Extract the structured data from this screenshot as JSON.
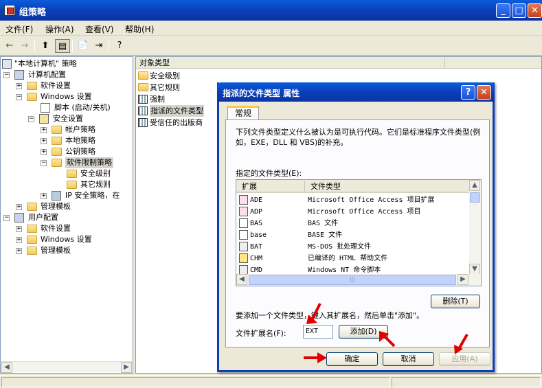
{
  "window": {
    "title": "组策略",
    "controls": [
      "_",
      "□",
      "✕"
    ]
  },
  "menu": [
    {
      "label": "文件(F)"
    },
    {
      "label": "操作(A)"
    },
    {
      "label": "查看(V)"
    },
    {
      "label": "帮助(H)"
    }
  ],
  "toolbar": {
    "back": "←",
    "forward": "→",
    "up": "⬆",
    "show_tree": "▤",
    "properties": "📄",
    "export": "⇥",
    "help": "?"
  },
  "tree": {
    "root": "\"本地计算机\" 策略",
    "computer_config": "计算机配置",
    "software_settings": "软件设置",
    "windows_settings": "Windows 设置",
    "scripts": "脚本 (启动/关机)",
    "security_settings": "安全设置",
    "account_policies": "帐户策略",
    "local_policies": "本地策略",
    "public_key_policies": "公钥策略",
    "srp": "软件限制策略",
    "security_levels": "安全级别",
    "additional_rules": "其它规则",
    "ip_security": "IP 安全策略，在",
    "admin_templates": "管理模板",
    "user_config": "用户配置",
    "user_software_settings": "软件设置",
    "user_windows_settings": "Windows 设置",
    "user_admin_templates": "管理模板"
  },
  "list": {
    "column": "对象类型",
    "items": [
      {
        "label": "安全级别",
        "icon": "folder"
      },
      {
        "label": "其它规则",
        "icon": "folder"
      },
      {
        "label": "强制",
        "icon": "rule"
      },
      {
        "label": "指派的文件类型",
        "icon": "rule"
      },
      {
        "label": "受信任的出版商",
        "icon": "rule"
      }
    ]
  },
  "dialog": {
    "title": "指派的文件类型 属性",
    "help_btn": "?",
    "close_btn": "✕",
    "tab": "常规",
    "description": "下列文件类型定义什么被认为是可执行代码。它们是标准程序文件类型(例如，EXE，DLL 和 VBS)的补充。",
    "list_label": "指定的文件类型(E):",
    "col_ext": "扩展",
    "col_type": "文件类型",
    "file_types": [
      {
        "ext": "ADE",
        "type": "Microsoft Office Access 项目扩展"
      },
      {
        "ext": "ADP",
        "type": "Microsoft Office Access 项目"
      },
      {
        "ext": "BAS",
        "type": "BAS 文件"
      },
      {
        "ext": "base",
        "type": "BASE 文件"
      },
      {
        "ext": "BAT",
        "type": "MS-DOS 批处理文件"
      },
      {
        "ext": "CHM",
        "type": "已编译的 HTML 帮助文件"
      },
      {
        "ext": "CMD",
        "type": "Windows NT 命令脚本"
      }
    ],
    "delete_btn": "删除(T)",
    "instruction": "要添加一个文件类型，键入其扩展名，然后单击\"添加\"。",
    "ext_label": "文件扩展名(F):",
    "ext_value": "EXT",
    "add_btn": "添加(D)",
    "ok_btn": "确定",
    "cancel_btn": "取消",
    "apply_btn": "应用(A)"
  },
  "annotation_color": "#e00000"
}
